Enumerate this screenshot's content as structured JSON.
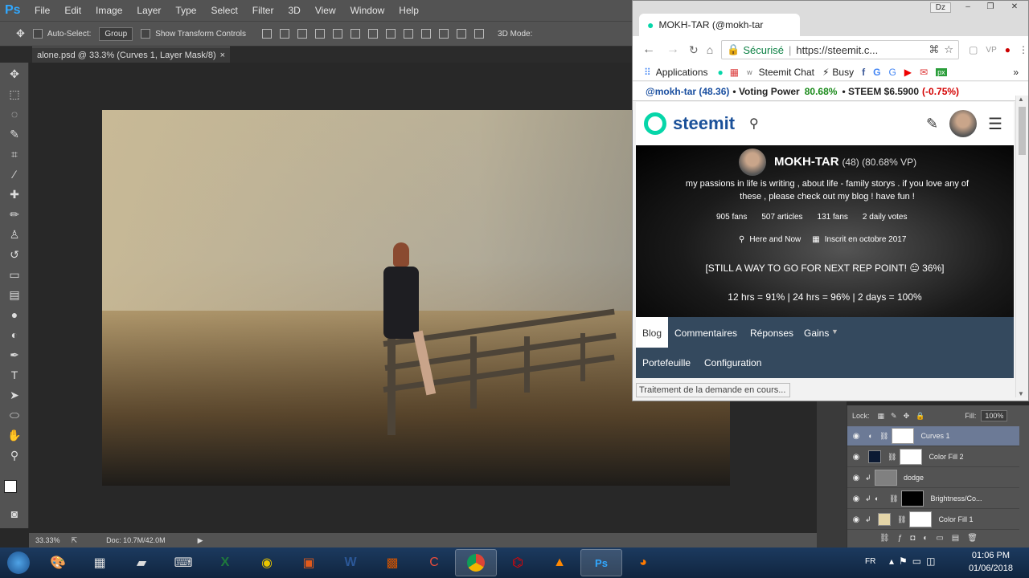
{
  "photoshop": {
    "logo": "Ps",
    "menu": [
      "File",
      "Edit",
      "Image",
      "Layer",
      "Type",
      "Select",
      "Filter",
      "3D",
      "View",
      "Window",
      "Help"
    ],
    "options": {
      "auto_select": "Auto-Select:",
      "group": "Group",
      "show_transform": "Show Transform Controls",
      "mode_3d": "3D Mode:"
    },
    "doc_tab": "alone.psd @ 33.3% (Curves 1, Layer Mask/8)",
    "doc_close": "×",
    "zoom": "33.33%",
    "doc_size": "Doc: 10.7M/42.0M",
    "layers": {
      "lock": "Lock:",
      "fill_label": "Fill:",
      "fill_value": "100%",
      "items": [
        {
          "name": "Curves 1"
        },
        {
          "name": "Color Fill 2"
        },
        {
          "name": "dodge"
        },
        {
          "name": "Brightness/Co..."
        },
        {
          "name": "Color Fill 1"
        }
      ]
    }
  },
  "browser": {
    "tab_title": "MOKH-TAR (@mokh-tar",
    "secure": "Sécurisé",
    "url": "https://steemit.c...",
    "window_user": "Dz",
    "bookmarks": [
      "Applications",
      "Steemit Chat",
      "Busy"
    ],
    "vp_bar": {
      "user": "@mokh-tar (48.36)",
      "vp_label": "• Voting Power",
      "vp_value": "80.68%",
      "steem_label": "• STEEM $6.5900",
      "steem_change": "(-0.75%)"
    },
    "steemit_logo": "steemit",
    "profile": {
      "name": "MOKH-TAR",
      "rep": "(48) (80.68% VP)",
      "bio": "my passions in life is writing , about life - family storys . if you love any of these , please check out my blog ! have fun !",
      "stats": [
        "905 fans",
        "507 articles",
        "131 fans",
        "2 daily votes"
      ],
      "location": "Here and Now",
      "joined": "Inscrit en octobre 2017",
      "rep_point": "[STILL A WAY TO GO FOR NEXT REP POINT! 😐 36%]",
      "hrs": "12 hrs = 91% | 24 hrs = 96% | 2 days = 100%"
    },
    "tabs": [
      "Blog",
      "Commentaires",
      "Réponses",
      "Gains"
    ],
    "tabs2": [
      "Portefeuille",
      "Configuration"
    ],
    "status": "Traitement de la demande en cours..."
  },
  "taskbar": {
    "lang": "FR",
    "time": "01:06 PM",
    "date": "01/06/2018"
  },
  "colors": {
    "vp_green": "#1a8a1a",
    "steem_red": "#d40000",
    "steemit_teal": "#06d6a9",
    "tab_bar": "#34495e"
  }
}
